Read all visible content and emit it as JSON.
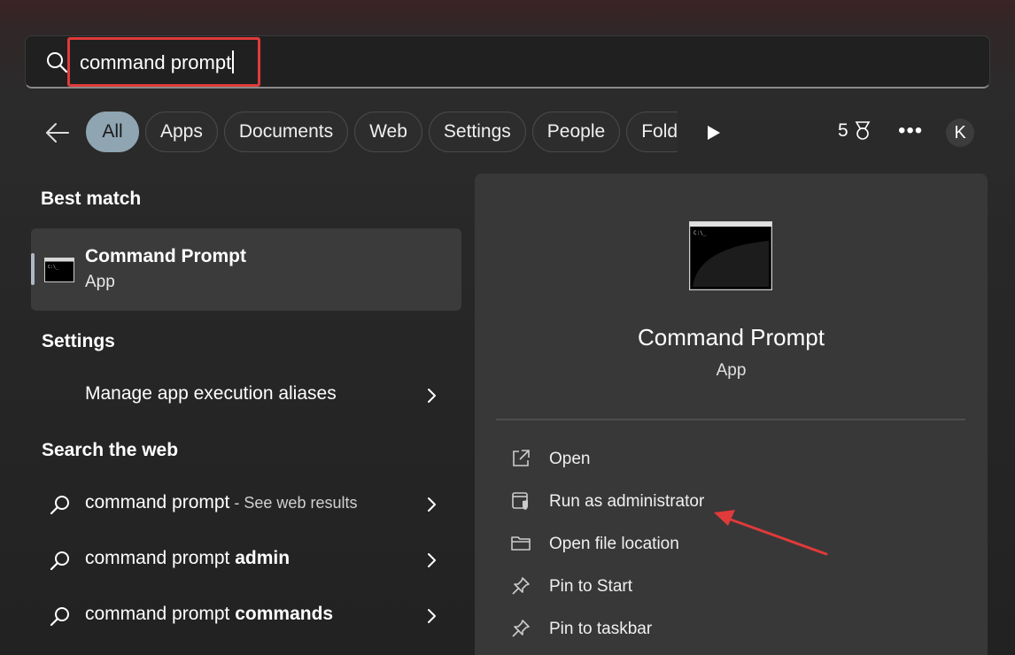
{
  "search": {
    "query": "command prompt"
  },
  "filters": [
    "All",
    "Apps",
    "Documents",
    "Web",
    "Settings",
    "People",
    "Fold"
  ],
  "header": {
    "points": "5",
    "more": "•••",
    "avatar": "K"
  },
  "best_match": {
    "heading": "Best match",
    "title": "Command Prompt",
    "subtitle": "App"
  },
  "settings": {
    "heading": "Settings",
    "item": "Manage app execution aliases"
  },
  "web": {
    "heading": "Search the web",
    "items": [
      {
        "plain": "command prompt",
        "bold": "",
        "muted": " - See web results"
      },
      {
        "plain": "command prompt ",
        "bold": "admin",
        "muted": ""
      },
      {
        "plain": "command prompt ",
        "bold": "commands",
        "muted": ""
      }
    ]
  },
  "detail": {
    "title": "Command Prompt",
    "subtitle": "App",
    "actions": [
      "Open",
      "Run as administrator",
      "Open file location",
      "Pin to Start",
      "Pin to taskbar"
    ]
  },
  "colors": {
    "highlight": "#e03a3a",
    "active_chip": "#8fa5b1",
    "panel": "#383838"
  }
}
